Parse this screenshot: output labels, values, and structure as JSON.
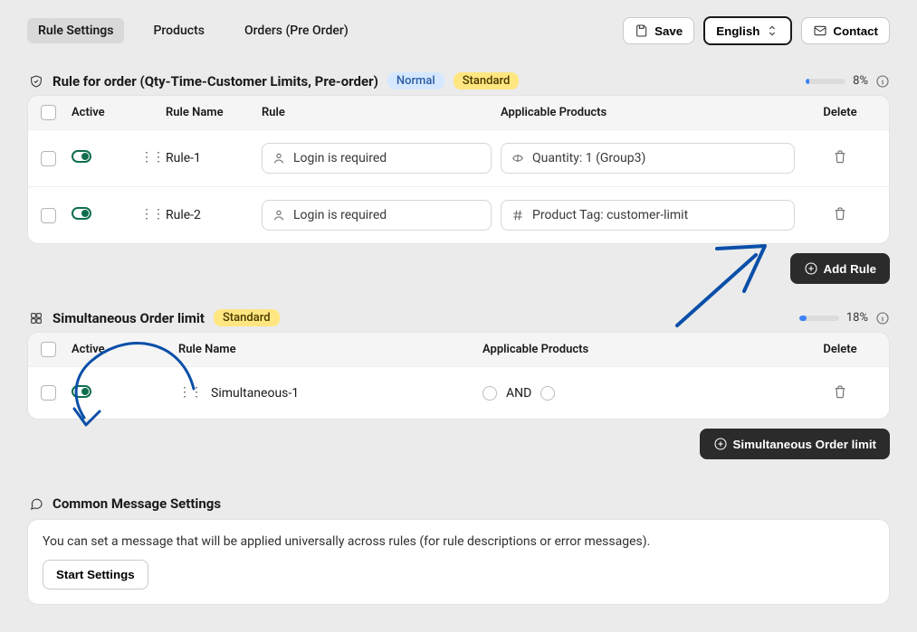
{
  "tabs": {
    "rule_settings": "Rule Settings",
    "products": "Products",
    "orders": "Orders (Pre Order)"
  },
  "top": {
    "save": "Save",
    "language": "English",
    "contact": "Contact"
  },
  "section1": {
    "title": "Rule for order (Qty-Time-Customer Limits, Pre-order)",
    "badge_normal": "Normal",
    "badge_standard": "Standard",
    "percent": "8%",
    "meter_width": "8%",
    "headers": {
      "active": "Active",
      "rule_name": "Rule Name",
      "rule": "Rule",
      "applicable": "Applicable Products",
      "delete": "Delete"
    },
    "rows": [
      {
        "name": "Rule-1",
        "rule_text": "Login is required",
        "prod_text": "Quantity: 1 (Group3)"
      },
      {
        "name": "Rule-2",
        "rule_text": "Login is required",
        "prod_text": "Product Tag: customer-limit"
      }
    ],
    "add_button": "Add Rule"
  },
  "section2": {
    "title": "Simultaneous Order limit",
    "badge_standard": "Standard",
    "percent": "18%",
    "meter_width": "18%",
    "headers": {
      "active": "Active",
      "rule_name": "Rule Name",
      "applicable": "Applicable Products",
      "delete": "Delete"
    },
    "rows": [
      {
        "name": "Simultaneous-1",
        "and_label": "AND"
      }
    ],
    "add_button": "Simultaneous Order limit"
  },
  "section3": {
    "title": "Common Message Settings",
    "desc": "You can set a message that will be applied universally across rules (for rule descriptions or error messages).",
    "button": "Start Settings"
  }
}
